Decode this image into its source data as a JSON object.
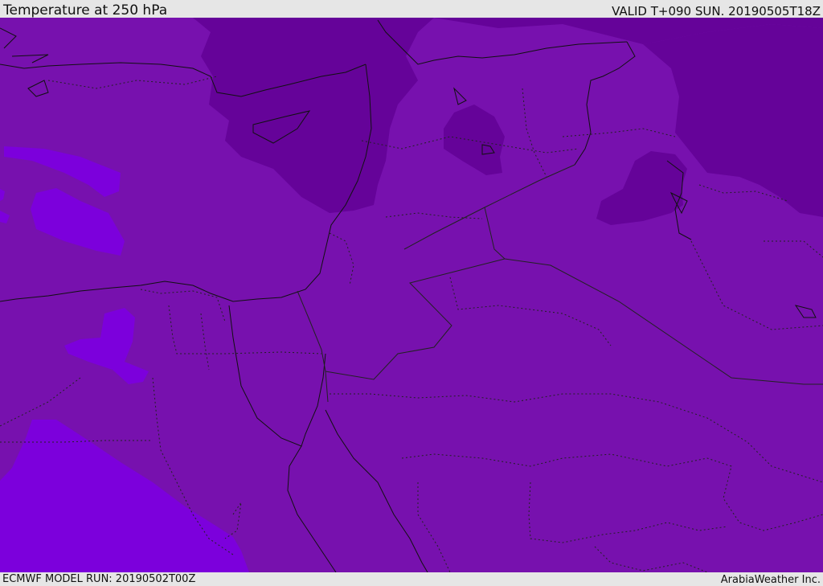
{
  "header": {
    "title": "Temperature at 250 hPa",
    "valid_time": "VALID T+090 SUN. 20190505T18Z"
  },
  "footer": {
    "model_run": "ECMWF MODEL RUN: 20190502T00Z",
    "credit": "ArabiaWeather Inc."
  },
  "colors": {
    "base_field": "#7711ae",
    "colder_band": "#650399",
    "warmer_band": "#7c00dc",
    "coastline": "#111111",
    "border": "#222222"
  }
}
